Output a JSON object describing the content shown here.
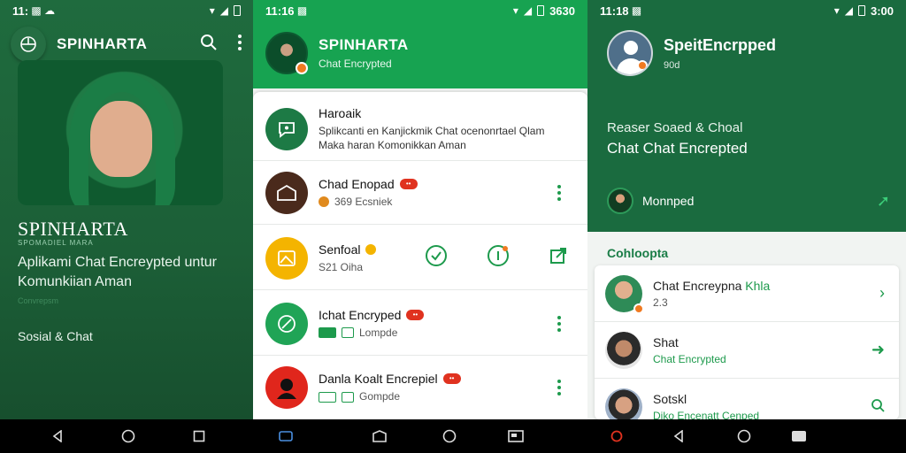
{
  "screen1": {
    "status": {
      "time": "11:",
      "glyphs": "▾◢"
    },
    "app_title": "SPINHARTA",
    "brand": "SPINHARTA",
    "brand_sub": "SPOMADIEL MARA",
    "tagline": "Aplikami Chat Encreypted untur Komunkiian Aman",
    "faint": "Convrepsm",
    "category": "Sosial & Chat"
  },
  "screen2": {
    "status": {
      "time": "11:16",
      "right": "3630"
    },
    "header": {
      "title": "SPINHARTA",
      "subtitle": "Chat Encrypted"
    },
    "chats": [
      {
        "name": "Haroaik",
        "line1": "Splikcanti en Kanjickmik Chat  ocenonrtael  Qlam",
        "line2": "Maka haran Komonikkan Aman",
        "avatar_color": "#1d7a45"
      },
      {
        "name": "Chad Enopad",
        "badge": "••",
        "meta": "369 Ecsniek",
        "avatar_color": "#4a2a1c"
      },
      {
        "name": "Senfoal",
        "meta": "S21 Oiha",
        "avatar_color": "#f4b400"
      },
      {
        "name": "Ichat Encryped",
        "badge": "••",
        "meta": "Lompde",
        "avatar_color": "#20a456"
      },
      {
        "name": "Danla Koalt Encrepiel",
        "badge": "••",
        "meta": "Gompde",
        "avatar_color": "#e0261c"
      }
    ]
  },
  "screen3": {
    "status": {
      "time": "11:18",
      "right": "3:00"
    },
    "header": {
      "title": "SpeitEncrpped",
      "subtitle": "90d"
    },
    "info1": "Reaser Soaed & Choal",
    "info2": "Chat  Chat Encrepted",
    "contact": "Monnped",
    "section": "Cohloopta",
    "list": [
      {
        "name": "Chat Encreypna",
        "name_hl": "Khla",
        "sub": "2.3",
        "sub_green": false,
        "avatar_color": "#2e8b57"
      },
      {
        "name": "Shat",
        "name_hl": "",
        "sub": "Chat Encrypted",
        "sub_green": true,
        "avatar_color": "#c08a6a"
      },
      {
        "name": "Sotskl",
        "name_hl": "",
        "sub": "Diko Encenatt Cenped",
        "sub_green": true,
        "avatar_color": "#d7a182"
      }
    ]
  },
  "colors": {
    "brand_green": "#17a351",
    "dark_green": "#1a6b3f",
    "accent_orange": "#f07a21",
    "badge_red": "#e0321f"
  }
}
